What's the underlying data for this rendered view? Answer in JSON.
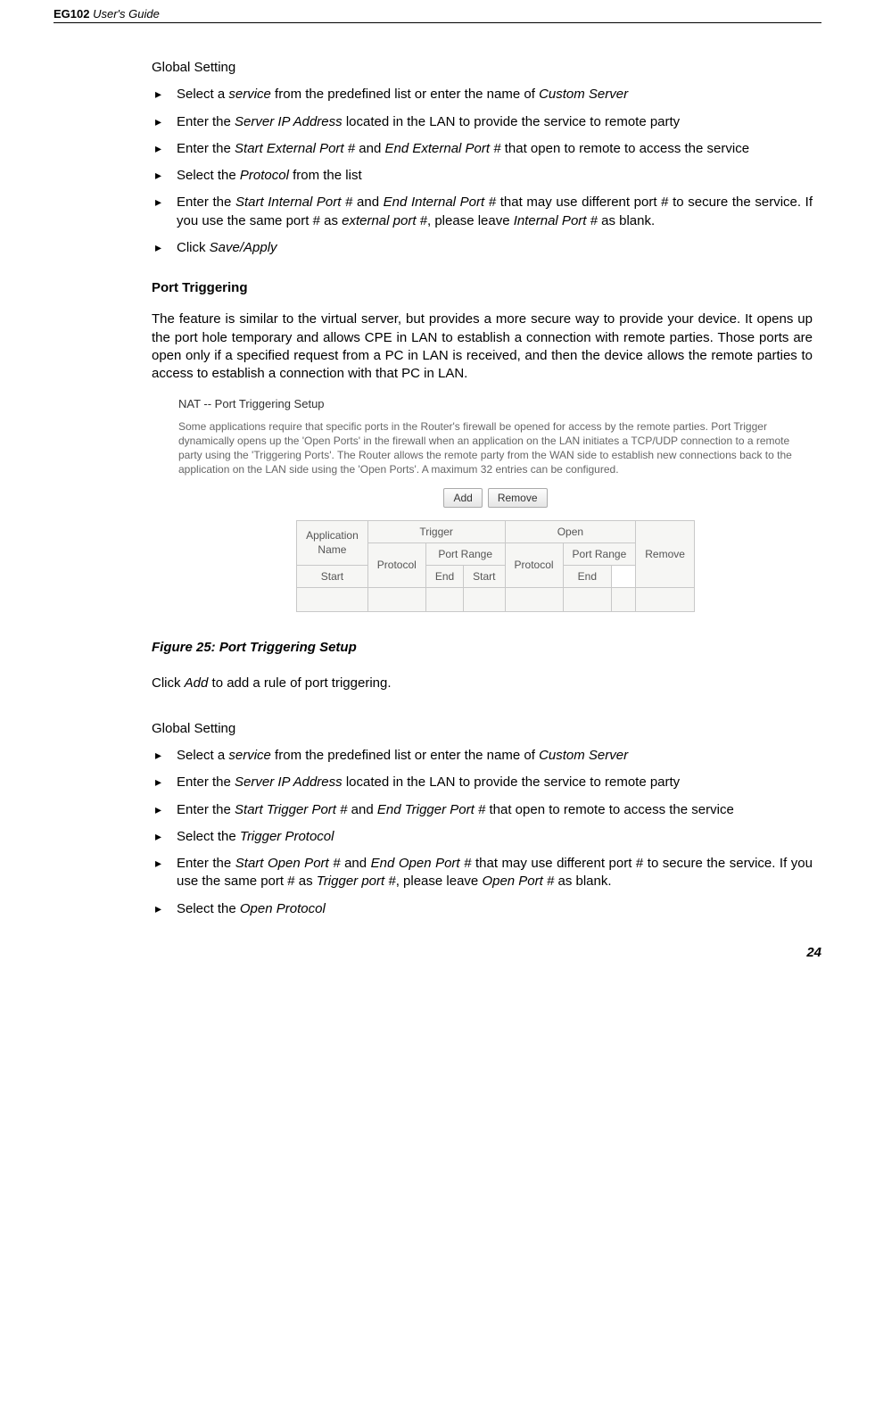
{
  "header": {
    "model": "EG102",
    "suffix": " User's Guide"
  },
  "gs1_title": "Global Setting",
  "gs1_items": [
    "Select a <i>service</i> from the predefined list or enter the name of <i>Custom Server</i>",
    "Enter the <i>Server IP Address</i> located in the LAN to provide the service to remote party",
    "Enter the <i>Start External Port #</i> and <i>End External Port #</i> that open to remote to access the service",
    "Select the <i>Protocol</i> from the list",
    "Enter the <i>Start Internal Port #</i> and <i>End Internal Port #</i> that may use different port # to secure the service. If you use the same port # as <i>external port #</i>, please leave <i>Internal Port #</i> as blank.",
    "Click <i>Save/Apply</i>"
  ],
  "port_trig_title": "Port Triggering",
  "port_trig_desc": "The feature is similar to the virtual server, but provides a more secure way to provide your device. It opens up the port hole temporary and allows CPE in LAN to establish a connection with remote parties. Those ports are open only if a specified request from a PC in LAN is received, and then the device allows the remote parties to access to establish a connection with that PC in LAN.",
  "embed": {
    "title": "NAT -- Port Triggering Setup",
    "desc": "Some applications require that specific ports in the Router's firewall be opened for access by the remote parties. Port Trigger dynamically opens up the 'Open Ports' in the firewall when an application on the LAN initiates a TCP/UDP connection to a remote party using the 'Triggering Ports'. The Router allows the remote party from the WAN side to establish new connections back to the application on the LAN side using the 'Open Ports'. A maximum 32 entries can be configured.",
    "btn_add": "Add",
    "btn_remove": "Remove",
    "cols": {
      "app": "Application",
      "name": "Name",
      "trigger": "Trigger",
      "open": "Open",
      "remove": "Remove",
      "protocol": "Protocol",
      "portrange": "Port Range",
      "start": "Start",
      "end": "End"
    }
  },
  "fig_caption": "Figure 25: Port Triggering Setup",
  "click_add": "Click <i>Add</i> to add a rule of port triggering.",
  "gs2_title": "Global Setting",
  "gs2_items": [
    "Select a <i>service</i> from the predefined list or enter the name of <i>Custom Server</i>",
    "Enter the <i>Server IP Address</i> located in the LAN to provide the service to remote party",
    "Enter the <i>Start Trigger Port #</i> and <i>End Trigger Port #</i> that open to remote to access the service",
    "Select the <i>Trigger Protocol</i>",
    "Enter the <i>Start Open Port #</i> and <i>End Open Port #</i> that may use different port # to secure the service. If you use the same port # as <i>Trigger port #</i>, please leave <i>Open Port #</i> as blank.",
    "Select the <i>Open Protocol</i>"
  ],
  "page_number": "24"
}
